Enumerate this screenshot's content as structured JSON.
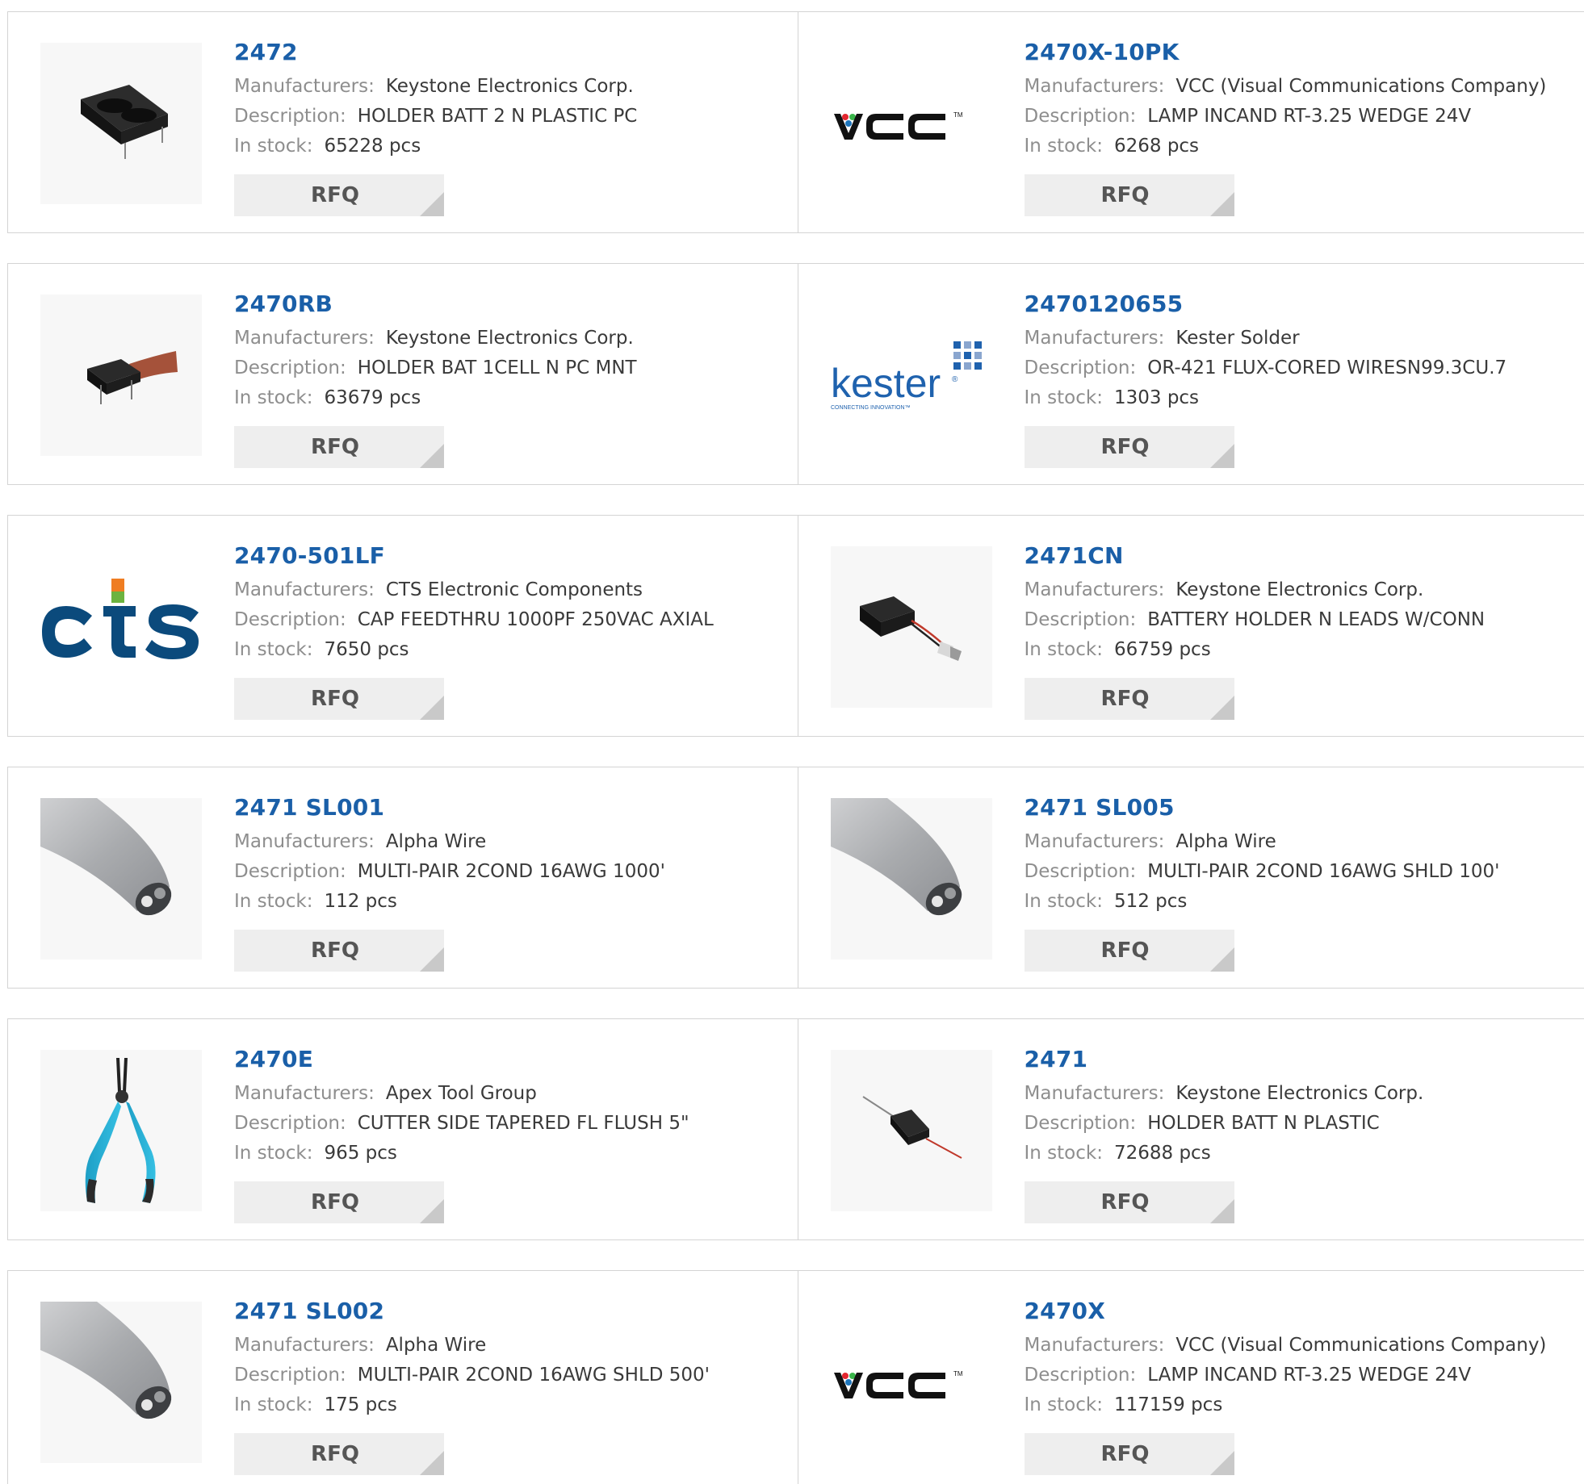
{
  "labels": {
    "manufacturers": "Manufacturers:",
    "description": "Description:",
    "in_stock": "In stock:",
    "rfq": "RFQ"
  },
  "colors": {
    "part_link": "#1a5fa8",
    "label": "#8e8e8e",
    "value": "#3a3a3a",
    "rfq_bg": "#eeeeee",
    "border": "#d4d4d4"
  },
  "products": [
    {
      "part": "2472",
      "manufacturer": "Keystone Electronics Corp.",
      "description": "HOLDER BATT 2 N PLASTIC PC",
      "stock": "65228 pcs",
      "image": "battery-holder-double-image"
    },
    {
      "part": "2470X-10PK",
      "manufacturer": "VCC (Visual Communications Company)",
      "description": "LAMP INCAND RT-3.25 WEDGE 24V",
      "stock": "6268 pcs",
      "image": "vcc-logo"
    },
    {
      "part": "2470RB",
      "manufacturer": "Keystone Electronics Corp.",
      "description": "HOLDER BAT 1CELL N PC MNT",
      "stock": "63679 pcs",
      "image": "battery-holder-ribbon-image"
    },
    {
      "part": "2470120655",
      "manufacturer": "Kester Solder",
      "description": "OR-421 FLUX-CORED WIRESN99.3CU.7",
      "stock": "1303 pcs",
      "image": "kester-logo"
    },
    {
      "part": "2470-501LF",
      "manufacturer": "CTS Electronic Components",
      "description": "CAP FEEDTHRU 1000PF 250VAC AXIAL",
      "stock": "7650 pcs",
      "image": "cts-logo"
    },
    {
      "part": "2471CN",
      "manufacturer": "Keystone Electronics Corp.",
      "description": "BATTERY HOLDER N LEADS W/CONN",
      "stock": "66759 pcs",
      "image": "battery-holder-connector-image"
    },
    {
      "part": "2471 SL001",
      "manufacturer": "Alpha Wire",
      "description": "MULTI-PAIR 2COND 16AWG 1000'",
      "stock": "112 pcs",
      "image": "cable-image"
    },
    {
      "part": "2471 SL005",
      "manufacturer": "Alpha Wire",
      "description": "MULTI-PAIR 2COND 16AWG SHLD 100'",
      "stock": "512 pcs",
      "image": "cable-image"
    },
    {
      "part": "2470E",
      "manufacturer": "Apex Tool Group",
      "description": "CUTTER SIDE TAPERED FL FLUSH 5\"",
      "stock": "965 pcs",
      "image": "pliers-image"
    },
    {
      "part": "2471",
      "manufacturer": "Keystone Electronics Corp.",
      "description": "HOLDER BATT N PLASTIC",
      "stock": "72688 pcs",
      "image": "battery-holder-leads-image"
    },
    {
      "part": "2471 SL002",
      "manufacturer": "Alpha Wire",
      "description": "MULTI-PAIR 2COND 16AWG SHLD 500'",
      "stock": "175 pcs",
      "image": "cable-image"
    },
    {
      "part": "2470X",
      "manufacturer": "VCC (Visual Communications Company)",
      "description": "LAMP INCAND RT-3.25 WEDGE 24V",
      "stock": "117159 pcs",
      "image": "vcc-logo"
    }
  ]
}
